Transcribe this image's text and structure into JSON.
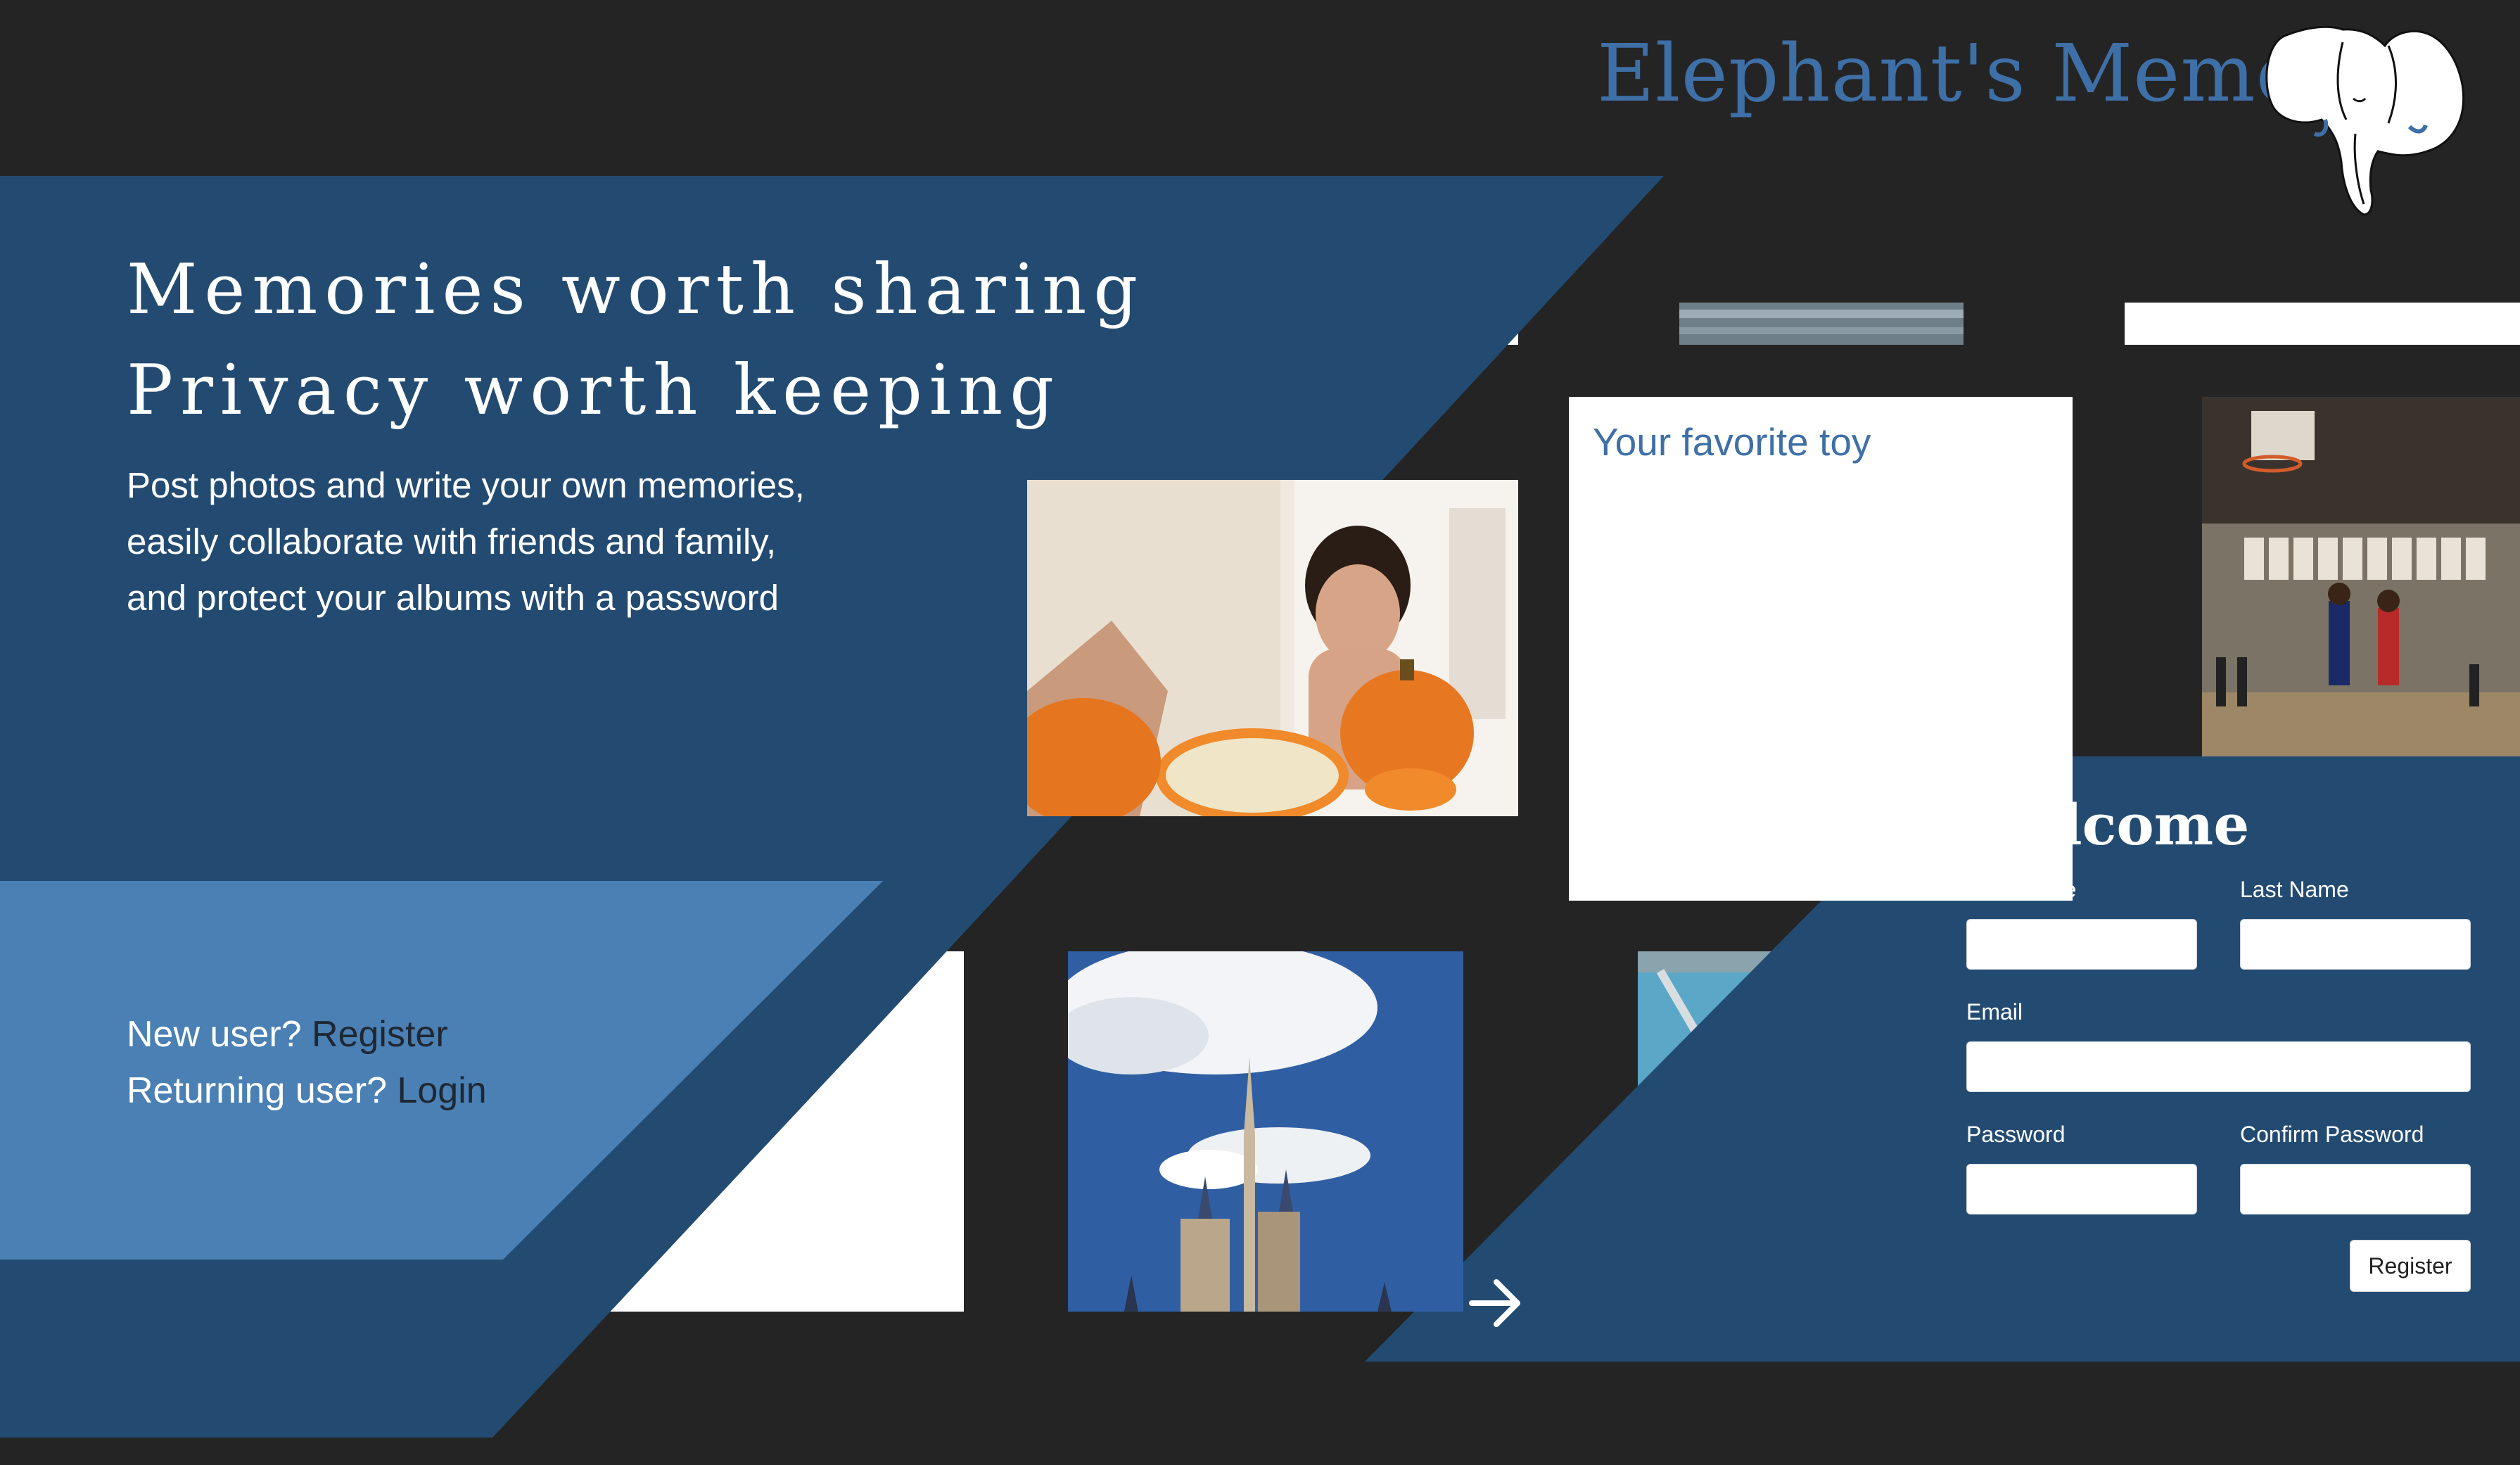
{
  "brand": {
    "name": "Elephant's Memory",
    "logo_icon": "elephant-logo-icon",
    "color": "#3E6FA7"
  },
  "hero": {
    "headline_line1": "Memories worth sharing",
    "headline_line2": "Privacy worth keeping",
    "subtext_line1": "Post photos and write your own memories,",
    "subtext_line2": "easily collaborate with friends and family,",
    "subtext_line3": "and protect your albums with a password"
  },
  "cta": {
    "new_user_prefix": "New user?",
    "register_link": "Register",
    "returning_user_prefix": "Returning user?",
    "login_link": "Login"
  },
  "tiles": {
    "favorite_toy_title": "Your favorite toy"
  },
  "form": {
    "title": "Welcome",
    "first_name_label": "First Name",
    "last_name_label": "Last Name",
    "email_label": "Email",
    "password_label": "Password",
    "confirm_password_label": "Confirm Password",
    "first_name_value": "",
    "last_name_value": "",
    "email_value": "",
    "password_value": "",
    "confirm_password_value": "",
    "submit_label": "Register"
  },
  "colors": {
    "background": "#242424",
    "dark_blue": "#234B72",
    "light_blue": "#4A80B4",
    "accent_text": "#3E6FA7"
  },
  "icons": {
    "next": "arrow-right-icon"
  }
}
